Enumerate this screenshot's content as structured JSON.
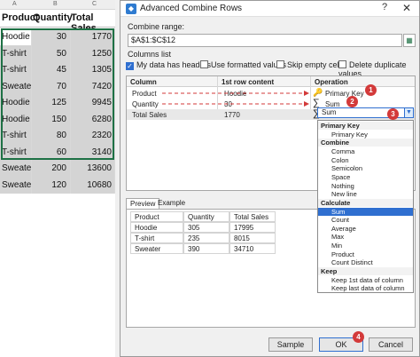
{
  "sheet": {
    "col_letters": [
      "A",
      "B",
      "C"
    ],
    "headers": [
      "Product",
      "Quantity",
      "Total Sales"
    ],
    "rows": [
      [
        "Hoodie",
        "30",
        "1770"
      ],
      [
        "T-shirt",
        "50",
        "1250"
      ],
      [
        "T-shirt",
        "45",
        "1305"
      ],
      [
        "Sweater",
        "70",
        "7420"
      ],
      [
        "Hoodie",
        "125",
        "9945"
      ],
      [
        "Hoodie",
        "150",
        "6280"
      ],
      [
        "T-shirt",
        "80",
        "2320"
      ],
      [
        "T-shirt",
        "60",
        "3140"
      ],
      [
        "Sweater",
        "200",
        "13600"
      ],
      [
        "Sweater",
        "120",
        "10680"
      ]
    ]
  },
  "dialog": {
    "title": "Advanced Combine Rows",
    "help": "?",
    "close": "✕",
    "combine_range_label": "Combine range:",
    "combine_range_value": "$A$1:$C$12",
    "columns_list_label": "Columns list",
    "checkboxes": [
      {
        "label": "My data has headers",
        "checked": true
      },
      {
        "label": "Use formatted values",
        "checked": false
      },
      {
        "label": "Skip empty cells",
        "checked": false
      },
      {
        "label": "Delete duplicate values",
        "checked": false
      }
    ],
    "grid_headers": [
      "Column",
      "1st row content",
      "Operation"
    ],
    "grid_rows": [
      {
        "column": "Product",
        "content": "Hoodie",
        "operation": "Primary Key",
        "icon": "key-icon"
      },
      {
        "column": "Quantity",
        "content": "30",
        "operation": "Sum",
        "icon": "sigma-icon"
      },
      {
        "column": "Total Sales",
        "content": "1770",
        "operation": "Sum",
        "icon": "sigma-icon"
      }
    ],
    "dropdown_value": "Sum",
    "menu": [
      {
        "type": "group",
        "label": "Primary Key"
      },
      {
        "type": "item",
        "label": "Primary Key"
      },
      {
        "type": "group",
        "label": "Combine"
      },
      {
        "type": "item",
        "label": "Comma"
      },
      {
        "type": "item",
        "label": "Colon"
      },
      {
        "type": "item",
        "label": "Semicolon"
      },
      {
        "type": "item",
        "label": "Space"
      },
      {
        "type": "item",
        "label": "Nothing"
      },
      {
        "type": "item",
        "label": "New line"
      },
      {
        "type": "group",
        "label": "Calculate"
      },
      {
        "type": "item",
        "label": "Sum",
        "active": true
      },
      {
        "type": "item",
        "label": "Count"
      },
      {
        "type": "item",
        "label": "Average"
      },
      {
        "type": "item",
        "label": "Max"
      },
      {
        "type": "item",
        "label": "Min"
      },
      {
        "type": "item",
        "label": "Product"
      },
      {
        "type": "item",
        "label": "Count Distinct"
      },
      {
        "type": "group",
        "label": "Keep"
      },
      {
        "type": "item",
        "label": "Keep 1st data of column"
      },
      {
        "type": "item",
        "label": "Keep last data of column"
      }
    ],
    "badges": [
      "1",
      "2",
      "3",
      "4"
    ],
    "tabs": [
      "Preview",
      "Example"
    ],
    "preview_headers": [
      "Product",
      "Quantity",
      "Total Sales"
    ],
    "preview_rows": [
      [
        "Hoodie",
        "305",
        "17995"
      ],
      [
        "T-shirt",
        "235",
        "8015"
      ],
      [
        "Sweater",
        "390",
        "34710"
      ]
    ],
    "buttons": {
      "sample": "Sample",
      "ok": "OK",
      "cancel": "Cancel"
    }
  },
  "colors": {
    "accent": "#2f6fd0",
    "badge": "#d33a3a",
    "excel_green": "#1e7145",
    "arrow": "#d33a3a"
  }
}
